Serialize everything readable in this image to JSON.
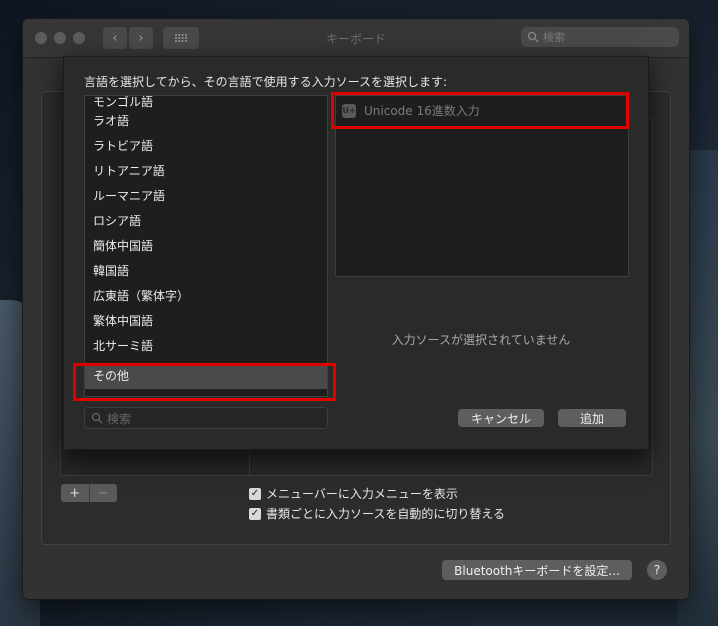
{
  "window": {
    "title": "キーボード",
    "search_placeholder": "検索"
  },
  "main": {
    "checkbox_show_menu": "メニューバーに入力メニューを表示",
    "checkbox_auto_switch": "書類ごとに入力ソースを自動的に切り替える",
    "bluetooth_button": "Bluetoothキーボードを設定...",
    "help_button": "?",
    "add_label": "+",
    "remove_label": "−"
  },
  "sheet": {
    "prompt": "言語を選択してから、その言語で使用する入力ソースを選択します:",
    "languages": [
      "モンゴル語",
      "ラオ語",
      "ラトビア語",
      "リトアニア語",
      "ルーマニア語",
      "ロシア語",
      "簡体中国語",
      "韓国語",
      "広東語（繁体字）",
      "繁体中国語",
      "北サーミ語",
      "その他"
    ],
    "selected_language": "その他",
    "source_item": "Unicode 16進数入力",
    "source_icon_text": "U+",
    "no_source_text": "入力ソースが選択されていません",
    "search_placeholder": "検索",
    "cancel_label": "キャンセル",
    "add_label": "追加"
  }
}
